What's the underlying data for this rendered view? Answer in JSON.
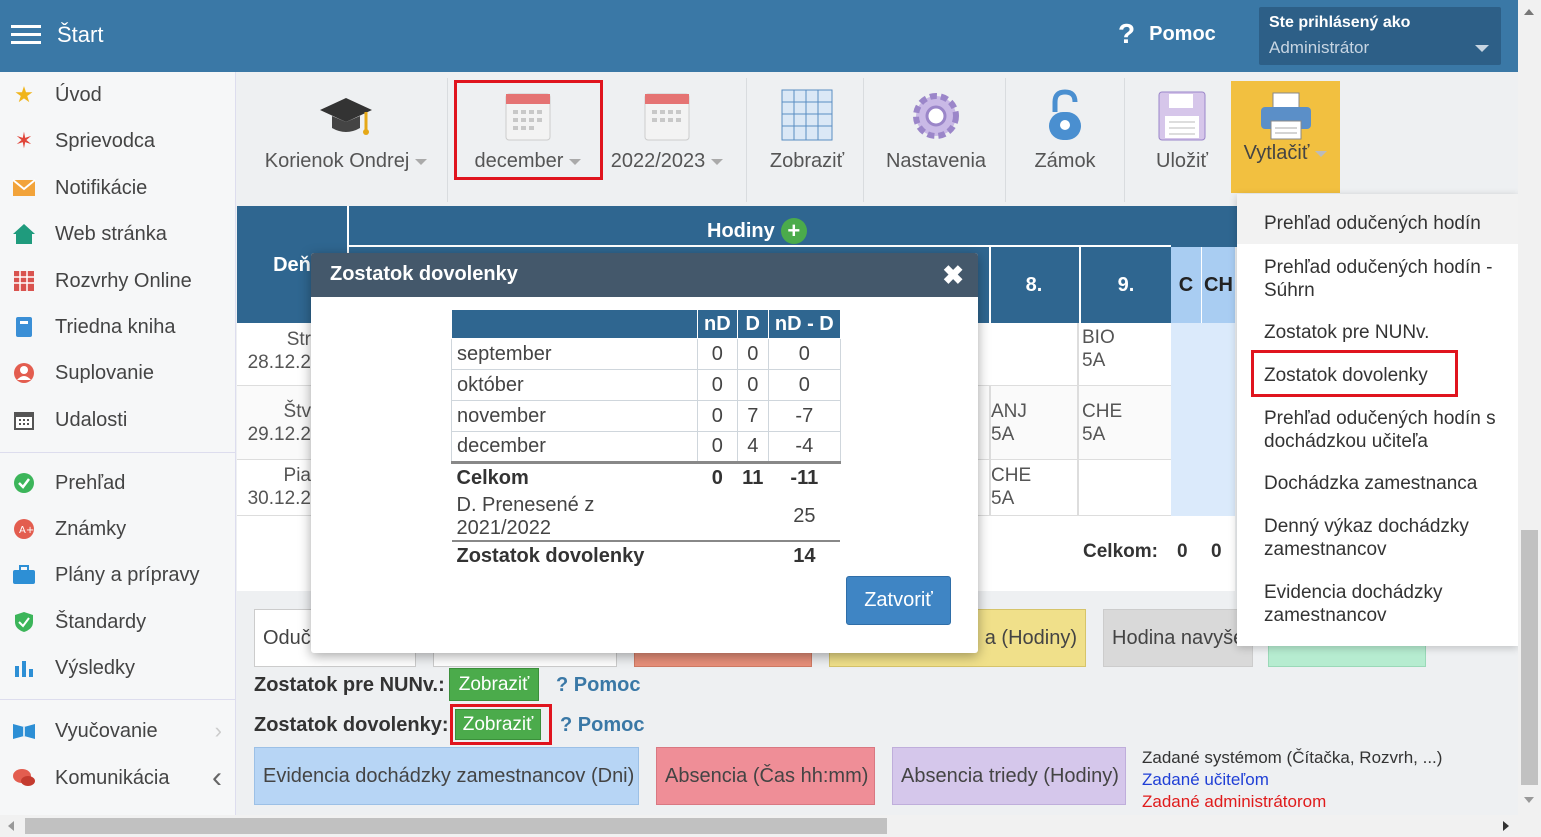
{
  "header": {
    "brand": "Štart",
    "help_label": "Pomoc",
    "user_title": "Ste prihlásený ako",
    "user_name": "Administrátor"
  },
  "sidebar": {
    "items": [
      {
        "label": "Úvod",
        "icon": "star-icon"
      },
      {
        "label": "Sprievodca",
        "icon": "wand-icon"
      },
      {
        "label": "Notifikácie",
        "icon": "envelope-icon"
      },
      {
        "label": "Web stránka",
        "icon": "home-icon"
      },
      {
        "label": "Rozvrhy Online",
        "icon": "timetable-icon"
      },
      {
        "label": "Triedna kniha",
        "icon": "book-icon"
      },
      {
        "label": "Suplovanie",
        "icon": "person-icon"
      },
      {
        "label": "Udalosti",
        "icon": "calendar-icon"
      },
      {
        "label": "Prehľad",
        "icon": "check-circle-icon"
      },
      {
        "label": "Známky",
        "icon": "grade-icon"
      },
      {
        "label": "Plány a prípravy",
        "icon": "briefcase-icon"
      },
      {
        "label": "Štandardy",
        "icon": "shield-icon"
      },
      {
        "label": "Výsledky",
        "icon": "bar-chart-icon"
      },
      {
        "label": "Vyučovanie",
        "icon": "open-book-icon"
      },
      {
        "label": "Komunikácia",
        "icon": "chat-icon"
      }
    ]
  },
  "toolbar": {
    "teacher": "Korienok Ondrej",
    "month": "december",
    "year": "2022/2023",
    "show": "Zobraziť",
    "settings": "Nastavenia",
    "lock": "Zámok",
    "save": "Uložiť",
    "print": "Vytlačiť"
  },
  "table": {
    "col_day": "Deň",
    "hours_title": "Hodiny",
    "col8": "8.",
    "col9": "9.",
    "colC": "C",
    "colCH": "CH",
    "rows": [
      {
        "day": "Str",
        "date": "28.12.2",
        "c8": "",
        "c9": "BIO\n5A"
      },
      {
        "day": "Štv",
        "date": "29.12.2",
        "c8": "ANJ\n5A",
        "c9": "CHE\n5A"
      },
      {
        "day": "Pia",
        "date": "30.12.2",
        "c8": "CHE\n5A",
        "c9": ""
      }
    ],
    "total_label": "Celkom:",
    "total_c": "0",
    "total_ch": "0"
  },
  "modal": {
    "title": "Zostatok dovolenky",
    "close_btn": "Zatvoriť",
    "headers": [
      "nD",
      "D",
      "nD - D"
    ],
    "rows": [
      {
        "m": "september",
        "nd": "0",
        "d": "0",
        "diff": "0"
      },
      {
        "m": "október",
        "nd": "0",
        "d": "0",
        "diff": "0"
      },
      {
        "m": "november",
        "nd": "0",
        "d": "7",
        "diff": "-7"
      },
      {
        "m": "december",
        "nd": "0",
        "d": "4",
        "diff": "-4"
      }
    ],
    "total": {
      "m": "Celkom",
      "nd": "0",
      "d": "11",
      "diff": "-11"
    },
    "carried": {
      "m": "D. Prenesené z 2021/2022",
      "diff": "25"
    },
    "balance": {
      "m": "Zostatok dovolenky",
      "diff": "14"
    }
  },
  "print_menu": [
    "Prehľad odučených hodín",
    "Prehľad odučených hodín - Súhrn",
    "Zostatok pre NUNv.",
    "Zostatok dovolenky",
    "Prehľad odučených hodín s dochádzkou učiteľa",
    "Dochádzka zamestnanca",
    "Denný výkaz dochádzky zamestnancov",
    "Evidencia dochádzky zamestnancov"
  ],
  "legend": {
    "oduc": "Oduč",
    "hodiny_partial": "a (Hodiny)",
    "navyse": "Hodina navyše"
  },
  "bottom": {
    "nunv_label": "Zostatok pre NUNv.:",
    "dov_label": "Zostatok dovolenky:",
    "show_btn": "Zobraziť",
    "help": "Pomoc",
    "ev_dni": "Evidencia dochádzky zamestnancov (Dni)",
    "absencia_cas": "Absencia (Čas hh:mm)",
    "absencia_triedy": "Absencia triedy (Hodiny)",
    "sys": "Zadané systémom (Čítačka, Rozvrh, ...)",
    "teacher": "Zadané učiteľom",
    "admin": "Zadané administrátorom"
  }
}
